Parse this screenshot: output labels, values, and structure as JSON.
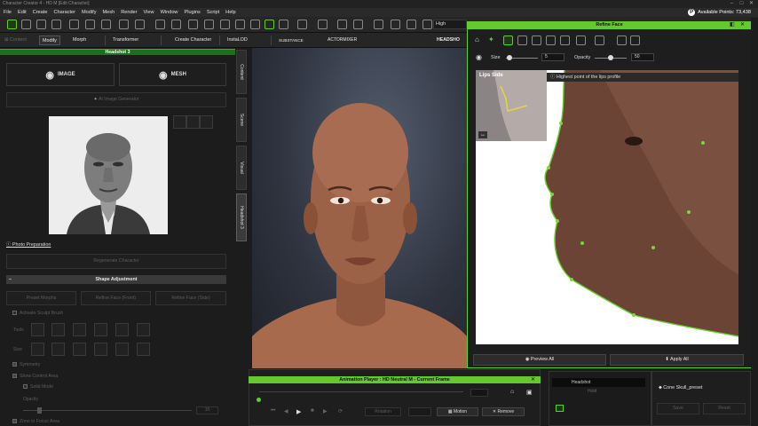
{
  "window": {
    "title": "Character Creator 4 - HD M [Edit Character]"
  },
  "menu": [
    "File",
    "Edit",
    "Create",
    "Character",
    "Modify",
    "Mesh",
    "Render",
    "View",
    "Window",
    "Plugins",
    "Script",
    "Help"
  ],
  "points": {
    "label": "Available Points: 73,438"
  },
  "toolbar": {
    "quality": "High"
  },
  "toolbar2": {
    "modify": "Modify",
    "morph": "Morph",
    "transformer": "Transformer",
    "create_character": "Create Character",
    "insta_lod": "InstaLOD",
    "substance": "SUBSTANCE",
    "actor_mixer": "ACTORMIXER",
    "headshot": "HEADSHO"
  },
  "left": {
    "tab_extend": "Content",
    "header": "Headshot 3",
    "image_btn": "IMAGE",
    "mesh_btn": "MESH",
    "ai_btn": "AI Image Generator",
    "photo_prep": "Photo Preparation",
    "regenerate": "Regenerate Character",
    "shape_header": "Shape Adjustment",
    "preset_morphs": "Preset Morphs",
    "refine_front": "Refine Face (Front)",
    "refine_side": "Refine Face (Side)",
    "sculpt": "Activate Sculpt Brush",
    "tools": "Tools",
    "size": "Size",
    "symmetry": "Symmetry",
    "show_control": "Show Control Area",
    "solid_mode": "Solid Mode",
    "opacity": "Opacity",
    "opacity_val": "10",
    "zone": "Zone in Focus Area"
  },
  "vtabs": [
    "Content",
    "Scene",
    "Visual",
    "Headshot 3"
  ],
  "refine": {
    "title": "Refine Face",
    "size_label": "Size",
    "size_val": "5",
    "opacity_label": "Opacity",
    "opacity_val": "50",
    "inset_title": "Lips Side",
    "hint": "Highest point of the lips profile",
    "preview": "Preview All",
    "apply": "Apply All"
  },
  "anim": {
    "title": "Animation Player : HD Neutral M - Current Frame",
    "rotate": "Rotation",
    "motion": "Motion",
    "remove": "Remove"
  },
  "tree": {
    "item1": "Headshot",
    "item2": "Hold"
  },
  "preset": {
    "label": "Cone Skull_preset",
    "save": "Save",
    "reset": "Reset"
  }
}
